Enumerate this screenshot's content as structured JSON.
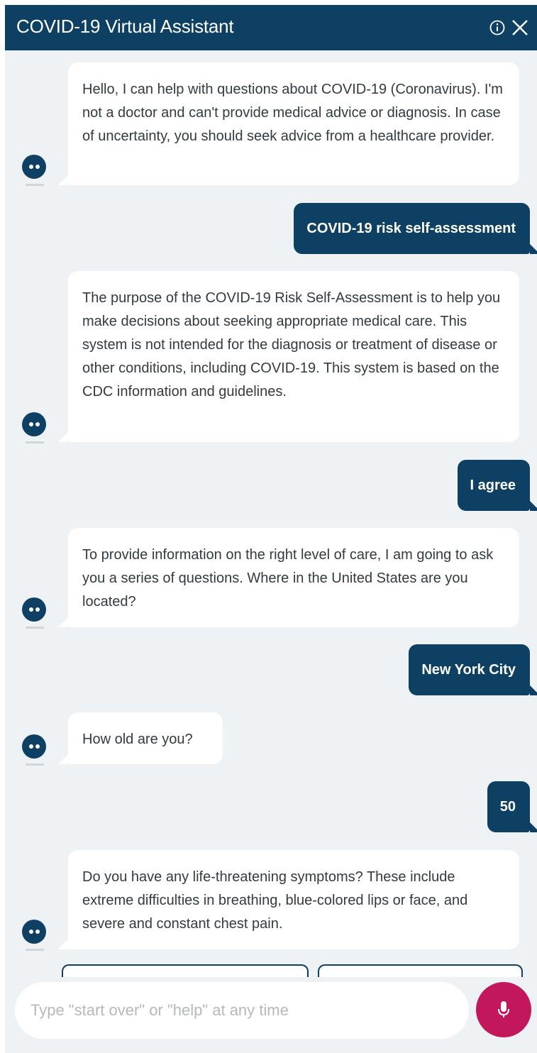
{
  "header": {
    "title": "COVID-19 Virtual Assistant",
    "info_icon": "info-circle-icon",
    "close_icon": "close-icon"
  },
  "messages": [
    {
      "from": "bot",
      "text": "Hello, I can help with questions about COVID-19 (Coronavirus). I'm not a doctor and can't provide medical advice or diagnosis. In case of uncertainty, you should seek advice from a healthcare provider."
    },
    {
      "from": "user",
      "text": "COVID-19 risk self-assessment"
    },
    {
      "from": "bot",
      "text": "The purpose of the COVID-19 Risk Self-Assessment is to help you make decisions about seeking appropriate medical care. This system is not intended for the diagnosis or treatment of disease or other conditions, including COVID-19. This system is based on the CDC information and guidelines."
    },
    {
      "from": "user",
      "text": "I agree"
    },
    {
      "from": "bot",
      "text": "To provide information on the right level of care, I am going to ask you a series of questions. Where in the United States are you located?"
    },
    {
      "from": "user",
      "text": "New York City"
    },
    {
      "from": "bot",
      "text": "How old are you?"
    },
    {
      "from": "user",
      "text": "50"
    },
    {
      "from": "bot",
      "text": "Do you have any life-threatening symptoms? These include extreme difficulties in breathing, blue-colored lips or face, and severe and constant chest pain."
    }
  ],
  "input": {
    "placeholder": "Type \"start over\" or \"help\" at any time"
  },
  "mic_icon": "microphone-icon",
  "colors": {
    "primary": "#0e4063",
    "background": "#eef2f5",
    "mic": "#c2185b"
  }
}
